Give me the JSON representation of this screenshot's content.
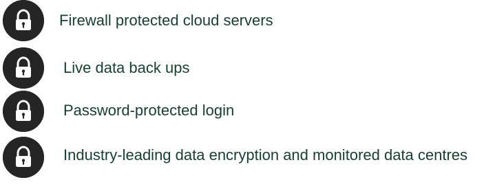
{
  "feature_list": {
    "items": [
      {
        "icon": "lock-icon",
        "label": "Firewall protected cloud servers"
      },
      {
        "icon": "lock-icon",
        "label": "Live data back ups"
      },
      {
        "icon": "lock-icon",
        "label": "Password-protected login"
      },
      {
        "icon": "lock-icon",
        "label": "Industry-leading data encryption and monitored data centres"
      }
    ]
  },
  "colors": {
    "text": "#163f2d",
    "icon_badge": "#252525",
    "icon_symbol": "#ffffff",
    "background": "#ffffff"
  }
}
